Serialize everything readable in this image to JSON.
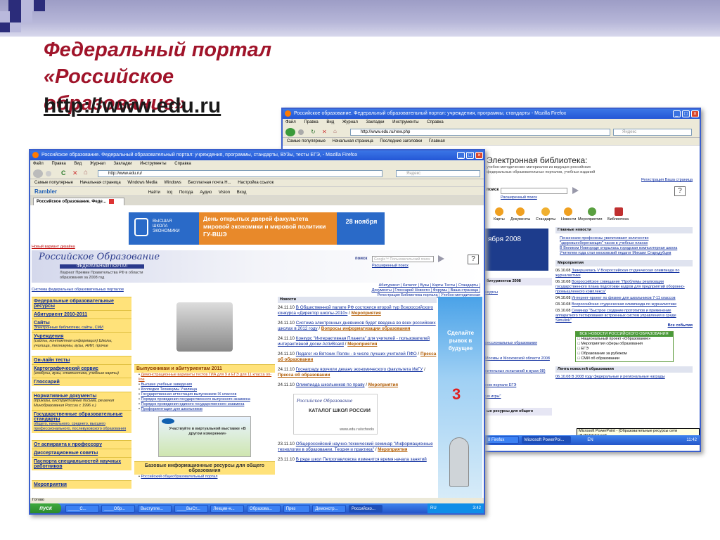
{
  "slide": {
    "title": "Федеральный портал «Российское образование»",
    "url": "http://www.edu.ru"
  },
  "back_window": {
    "title": "Российское образование. Федеральный образовательный портал: учреждения, программы, стандарты - Mozilla Firefox",
    "menu": [
      "Файл",
      "Правка",
      "Вид",
      "Журнал",
      "Закладки",
      "Инструменты",
      "Справка"
    ],
    "address": "http://www.edu.ru/new.php",
    "bookmarks": [
      "Самые популярные",
      "Начальная страница",
      "Последние заголовки",
      "Главная"
    ],
    "library_heading": "Электронная библиотека:",
    "library_sub": "учебно-методических материалов из ведущих российских федеральных образовательных порталов, учебных изданий",
    "links_right": "Регистрация  Ваша страница",
    "search_label": "поиск",
    "advanced_search": "Расширенный поиск",
    "icons": [
      "Карты",
      "Документы",
      "Стандарты",
      "Новости",
      "Мероприятия",
      "Библиотека"
    ],
    "main_news_header": "Главные новости",
    "main_news": [
      "Пензенские профсоюзы увеличивают количество \"здоровьесберегающих\" часов в учебных планах",
      "В Великом Новгороде открылась городская компьютерная школа",
      "Учителем года стал московский педагог Михаил Стародубцев"
    ],
    "events_header": "Мероприятия",
    "events": [
      {
        "date": "06.10.08",
        "text": "Завершилась V Всероссийская студенческая олимпиада по журналистике"
      },
      {
        "date": "06.10.08",
        "text": "Всероссийское совещание \"Проблемы реализации государственного плана подготовки кадров для предприятий оборонно-промышленного комплекса\""
      },
      {
        "date": "04.10.08",
        "text": "Интернет-проект по физике для школьников 7-11 классов"
      },
      {
        "date": "03.10.08",
        "text": "Всероссийская студенческая олимпиада по журналистике"
      },
      {
        "date": "03.10.08",
        "text": "Семинар \"Быстрое создание прототипов и применение аппаратного тестирования встроенных систем управления в среде Simulink\""
      }
    ],
    "all_events": "Все события",
    "date_partial": "ября 2008",
    "abiturient": "битуриентов 2008",
    "left_items": [
      "нкурсы",
      "рессиональных образования",
      "Москвы и Московской области 2008",
      "нительных испытаний в вузах 08)",
      "ном портале ЕГЭ",
      "ую игры\"",
      "ые ресурсы для общего"
    ],
    "subscribe_header": "ВСЕ НОВОСТИ РОССИЙСКОГО ОБРАЗОВАНИЯ",
    "subscribe_items": [
      "Национальный проект «Образование»",
      "Мероприятия сферы образования",
      "ЕГЭ",
      "Образование за рубежом",
      "СМИ об образовании"
    ],
    "feed_header": "Лента новостей образования",
    "feed_first": "06.10.08 В 2008 году федеральные и региональные награды",
    "taskbar": [
      "8 Firefox",
      "Microsoft PowerPoi...",
      "EN"
    ],
    "clock": "11:42",
    "tooltip": "Microsoft PowerPoint - [Образовательные ресурсы сети ИНТЕРНЕТ.ppt]"
  },
  "front_window": {
    "title": "Российское образование. Федеральный образовательный портал: учреждения, программы, стандарты, ВУЗы, тесты ЕГЭ, - Mozilla Firefox",
    "menu": [
      "Файл",
      "Правка",
      "Вид",
      "Журнал",
      "Закладки",
      "Инструменты",
      "Справка"
    ],
    "address": "http://www.edu.ru/",
    "search_placeholder": "Яндекс",
    "bookmarks": [
      "Самые популярные",
      "Начальная страница",
      "Windows Media",
      "Windows",
      "Бесплатная почта H...",
      "Настройка ссылок"
    ],
    "rambler": "Rambler",
    "rambler_items": [
      "Найти",
      "icq",
      "Погода",
      "Аудио",
      "Vision",
      "Вход"
    ],
    "tab": "Российское образование. Феде...",
    "banner": {
      "school": "ВЫСШАЯ ШКОЛА ЭКОНОМИКИ",
      "text": "День открытых дверей факультета мировой экономики и мировой политики ГУ-ВШЭ",
      "date": "28 ноября"
    },
    "old_version": "Новый вариант дизайна",
    "portal_logo": "Российское Образование",
    "portal_sub": "ФЕДЕРАЛЬНЫЙ ПОРТАЛ",
    "laureate": "Лауреат Премии Правительства РФ в области образования за 2008 год",
    "search_label": "поиск",
    "search_box": "Google™ Пользовательский поиск",
    "advanced_search": "Расширенный поиск",
    "top_links": "Абитуриент | Каталог | Вузы | Карты Тесты | Стандарты | Документы | Глоссарий Новости | Форумы | Ваша страница | Регистрация Библиотека портала | Учебно-методическая библиотека",
    "system_link": "Система федеральных образовательных порталов",
    "left_nav": [
      {
        "title": "Федеральные образовательные ресурсы"
      },
      {
        "title": "Абитуриент 2010-2011"
      },
      {
        "title": "Сайты",
        "sub": "Электронные библиотеки, сайты, СМИ"
      },
      {
        "title": "Учреждения",
        "sub": "(сайты, контактная информация) Школы, училища, техникумы, вузы, НИИ, прочие"
      },
      {
        "title": "Он-лайн тесты"
      },
      {
        "title": "Картографический сервис",
        "sub": "(глобусы, вузы, статистика, учебные карты)"
      },
      {
        "title": "Глоссарий"
      },
      {
        "title": "Нормативные документы",
        "sub": "(приказы, инструктивные письма, решения Минобразования России с 1996 г.)"
      },
      {
        "title": "Государственные образовательные стандарты",
        "sub": "общего, начального, среднего, высшего профессионального, послевузовского образования"
      },
      {
        "title": "От аспиранта к профессору"
      },
      {
        "title": "Диссертационные советы"
      },
      {
        "title": "Паспорта специальностей научных работников"
      },
      {
        "title": "Мероприятия"
      }
    ],
    "abit_header": "Выпускникам и абитуриентам 2011",
    "abit_items": [
      "Демонстрационные варианты тестов ГИА для 9 и ЕГЭ для 11 класса on-line",
      "Высшие учебные заведения",
      "Колледжи Техникумы Училища",
      "Государственная аттестация выпускников IX классов",
      "Порядок проведения государственного выпускного экзамена",
      "Порядок проведения единого государственного экзамена",
      "Профориентация для школьников"
    ],
    "intel_ad": "Участвуйте в виртуальной выставке «В другом измерении»",
    "base_header": "Базовые информационные ресурсы для общего образования",
    "base_first": "Российский общеобразовательный портал",
    "news_header": "Новости",
    "news": [
      {
        "date": "24.11.10",
        "text": "В Общественной палате РФ состоялся второй тур Всероссийского конкурса «Директор школы-2010»",
        "tag": "Мероприятия"
      },
      {
        "date": "24.11.10",
        "text": "Система электронных дневников будет введена во всех российских школах в 2012 году",
        "tag": "Вопросы информатизации образования"
      },
      {
        "date": "24.11.10",
        "text": "Конкурс \"Интерактивная Планета\" для учителей - пользователей интерактивной доски ActivBoard",
        "tag": "Мероприятия"
      },
      {
        "date": "24.11.10",
        "text": "Педагог из Вятских Полян - в числе лучших учителей ПФО",
        "tag": "Пресса об образовании"
      },
      {
        "date": "24.11.10",
        "text": "Госнаграду вручили декану экономического факультета ИвГУ",
        "tag": "Пресса об образовании"
      },
      {
        "date": "24.11.10",
        "text": "Олимпиада школьников по праву",
        "tag": "Мероприятия"
      },
      {
        "date": "23.11.10",
        "text": "Общероссийский научно-технический семинар \"Информационные технологии в образовании. Теория и практика\"",
        "tag": "Мероприятия"
      },
      {
        "date": "23.11.10",
        "text": "В ряде школ Петропавловска изменится время начала занятий",
        "tag": ""
      }
    ],
    "catalog_logo": "Российское Образование",
    "catalog_text": "КАТАЛОГ ШКОЛ РОССИИ",
    "catalog_url": "www.edu.ru/schools",
    "side_ad": {
      "text": "Сделайте рывок в будущее",
      "number": "3"
    },
    "status": "Готово",
    "taskbar": [
      "пуск",
      "_____C...",
      "____Обр...",
      "Выступле...",
      "____ВыСт...",
      "Лекции-н...",
      "Образова...",
      "През",
      "Демонстр...",
      "Российско..."
    ],
    "lang": "RU",
    "clock": "3:42"
  },
  "colors": {
    "accent_title": "#a0142a",
    "window_blue": "#2457d6",
    "nav_yellow": "#ffe27a",
    "portal_navy": "#2a3a8c"
  }
}
